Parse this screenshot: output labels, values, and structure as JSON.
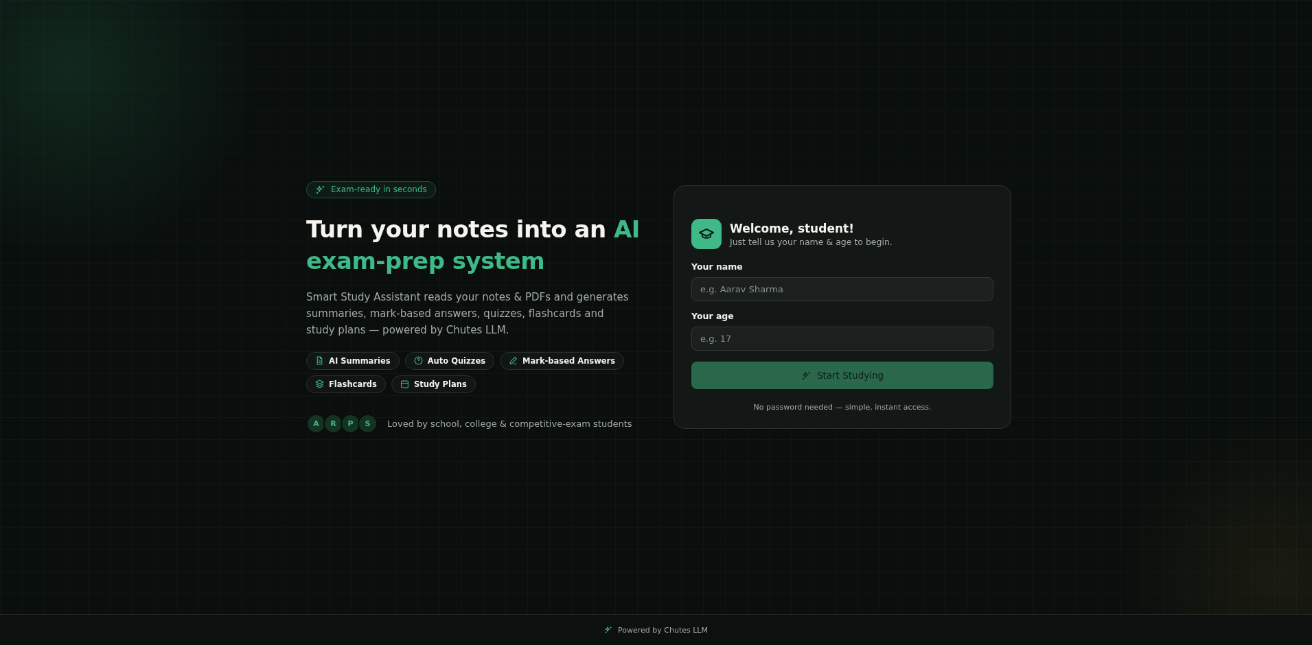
{
  "hero": {
    "badge": "Exam-ready in seconds",
    "title_main": "Turn your notes into an ",
    "title_accent": "AI exam-prep system",
    "description": "Smart Study Assistant reads your notes & PDFs and generates summaries, mark-based answers, quizzes, flashcards and study plans — powered by Chutes LLM.",
    "features": [
      {
        "kind": "document",
        "label": "AI Summaries"
      },
      {
        "kind": "question",
        "label": "Auto Quizzes"
      },
      {
        "kind": "pen",
        "label": "Mark-based Answers"
      },
      {
        "kind": "layers",
        "label": "Flashcards"
      },
      {
        "kind": "calendar",
        "label": "Study Plans"
      }
    ],
    "avatars": [
      "A",
      "R",
      "P",
      "S"
    ],
    "social_proof": "Loved by school, college & competitive-exam students"
  },
  "card": {
    "title": "Welcome, student!",
    "subtitle": "Just tell us your name & age to begin.",
    "fields": [
      {
        "label": "Your name",
        "placeholder": "e.g. Aarav Sharma"
      },
      {
        "label": "Your age",
        "placeholder": "e.g. 17"
      }
    ],
    "button": {
      "label": "Start Studying",
      "disabled": true
    },
    "note": "No password needed — simple, instant access."
  },
  "footer": {
    "text": "Powered by Chutes LLM"
  }
}
